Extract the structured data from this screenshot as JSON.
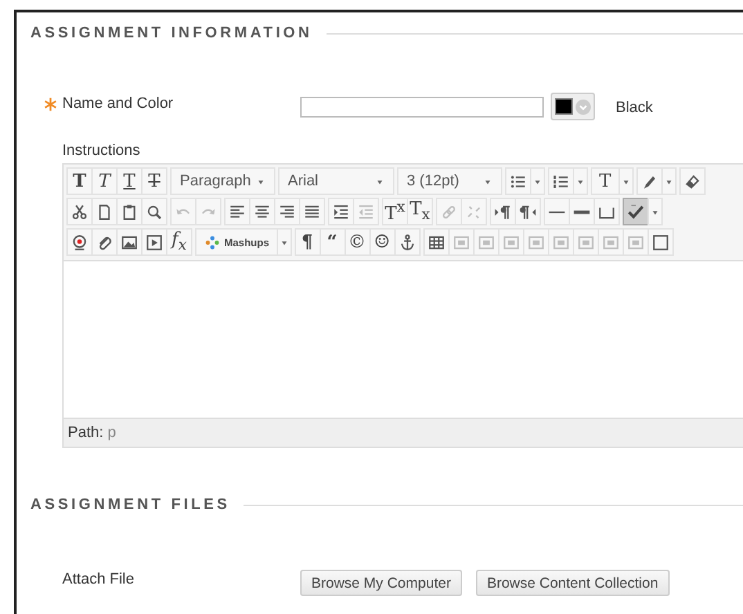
{
  "assignment_information": {
    "title": "ASSIGNMENT INFORMATION",
    "name_field": {
      "label": "Name and Color",
      "required": true
    },
    "color": {
      "label": "Black"
    },
    "instructions": {
      "label": "Instructions",
      "toolbar": [
        [
          [
            {
              "kind": "glyph",
              "text": "T",
              "disabled": false,
              "pressed": false
            },
            {
              "kind": "glyph",
              "text": "T",
              "disabled": false,
              "pressed": false
            },
            {
              "kind": "glyph",
              "text": "T",
              "disabled": false,
              "pressed": false
            },
            {
              "kind": "glyph",
              "text": "T",
              "disabled": false,
              "pressed": false
            }
          ],
          [
            {
              "kind": "dropdown",
              "text": "Paragraph",
              "disabled": false,
              "pressed": false
            }
          ],
          [
            {
              "kind": "dropdown",
              "text": "Arial",
              "disabled": false,
              "pressed": false
            }
          ],
          [
            {
              "kind": "dropdown",
              "text": "3 (12pt)",
              "disabled": false,
              "pressed": false
            }
          ],
          [
            {
              "kind": "split-icon",
              "disabled": false,
              "pressed": false
            }
          ],
          [
            {
              "kind": "split-icon",
              "disabled": false,
              "pressed": false
            }
          ],
          [
            {
              "kind": "split-glyph",
              "text": "T",
              "disabled": false,
              "pressed": false
            }
          ],
          [
            {
              "kind": "split-icon",
              "disabled": false,
              "pressed": false
            }
          ],
          [
            {
              "kind": "icon",
              "disabled": false,
              "pressed": false
            }
          ]
        ],
        [
          [
            {
              "kind": "icon",
              "disabled": false,
              "pressed": false
            },
            {
              "kind": "icon",
              "disabled": false,
              "pressed": false
            },
            {
              "kind": "icon",
              "disabled": false,
              "pressed": false
            },
            {
              "kind": "icon",
              "disabled": false,
              "pressed": false
            }
          ],
          [
            {
              "kind": "icon",
              "disabled": true,
              "pressed": false
            },
            {
              "kind": "icon",
              "disabled": true,
              "pressed": false
            }
          ],
          [
            {
              "kind": "icon",
              "disabled": false,
              "pressed": false
            },
            {
              "kind": "icon",
              "disabled": false,
              "pressed": false
            },
            {
              "kind": "icon",
              "disabled": false,
              "pressed": false
            },
            {
              "kind": "icon",
              "disabled": false,
              "pressed": false
            }
          ],
          [
            {
              "kind": "icon",
              "disabled": false,
              "pressed": false
            },
            {
              "kind": "icon",
              "disabled": true,
              "pressed": false
            }
          ],
          [
            {
              "kind": "glyph",
              "text": "T$^{x}$",
              "disabled": false,
              "pressed": false
            },
            {
              "kind": "glyph",
              "text": "T$_{x}$",
              "disabled": false,
              "pressed": false
            }
          ],
          [
            {
              "kind": "icon",
              "disabled": true,
              "pressed": false
            },
            {
              "kind": "icon",
              "disabled": true,
              "pressed": false
            }
          ],
          [
            {
              "kind": "icon",
              "disabled": false,
              "pressed": false
            },
            {
              "kind": "icon",
              "disabled": false,
              "pressed": false
            }
          ],
          [
            {
              "kind": "icon",
              "disabled": false,
              "pressed": false
            },
            {
              "kind": "icon",
              "disabled": false,
              "pressed": false
            },
            {
              "kind": "icon",
              "disabled": false,
              "pressed": false
            }
          ],
          [
            {
              "kind": "split-icon",
              "disabled": false,
              "pressed": true
            }
          ]
        ],
        [
          [
            {
              "kind": "icon",
              "disabled": false,
              "pressed": false
            },
            {
              "kind": "icon",
              "disabled": false,
              "pressed": false
            },
            {
              "kind": "icon",
              "disabled": false,
              "pressed": false
            },
            {
              "kind": "icon",
              "disabled": false,
              "pressed": false
            },
            {
              "kind": "glyph",
              "text": "f$_{x}$",
              "disabled": false,
              "pressed": false
            }
          ],
          [
            {
              "kind": "split-icon",
              "text": "Mashups",
              "disabled": false,
              "pressed": false
            }
          ],
          [
            {
              "kind": "glyph",
              "text": "¶",
              "disabled": false,
              "pressed": false
            },
            {
              "kind": "glyph",
              "text": "“",
              "disabled": false,
              "pressed": false
            },
            {
              "kind": "glyph",
              "text": "©",
              "disabled": false,
              "pressed": false
            },
            {
              "kind": "glyph",
              "text": "☺",
              "disabled": false,
              "pressed": false
            },
            {
              "kind": "icon",
              "disabled": false,
              "pressed": false
            }
          ],
          [
            {
              "kind": "icon",
              "disabled": false,
              "pressed": false
            },
            {
              "kind": "icon",
              "disabled": true,
              "pressed": false
            },
            {
              "kind": "icon",
              "disabled": true,
              "pressed": false
            },
            {
              "kind": "icon",
              "disabled": true,
              "pressed": false
            },
            {
              "kind": "icon",
              "disabled": true,
              "pressed": false
            },
            {
              "kind": "icon",
              "disabled": true,
              "pressed": false
            },
            {
              "kind": "icon",
              "disabled": true,
              "pressed": false
            },
            {
              "kind": "icon",
              "disabled": true,
              "pressed": false
            },
            {
              "kind": "icon",
              "disabled": true,
              "pressed": false
            },
            {
              "kind": "icon",
              "disabled": false,
              "pressed": false
            }
          ]
        ]
      ],
      "path_label": "Path:",
      "path_value": "p"
    }
  },
  "assignment_files": {
    "title": "ASSIGNMENT FILES",
    "attach": {
      "label": "Attach File",
      "buttons": [
        "Browse My Computer",
        "Browse Content Collection"
      ]
    }
  }
}
